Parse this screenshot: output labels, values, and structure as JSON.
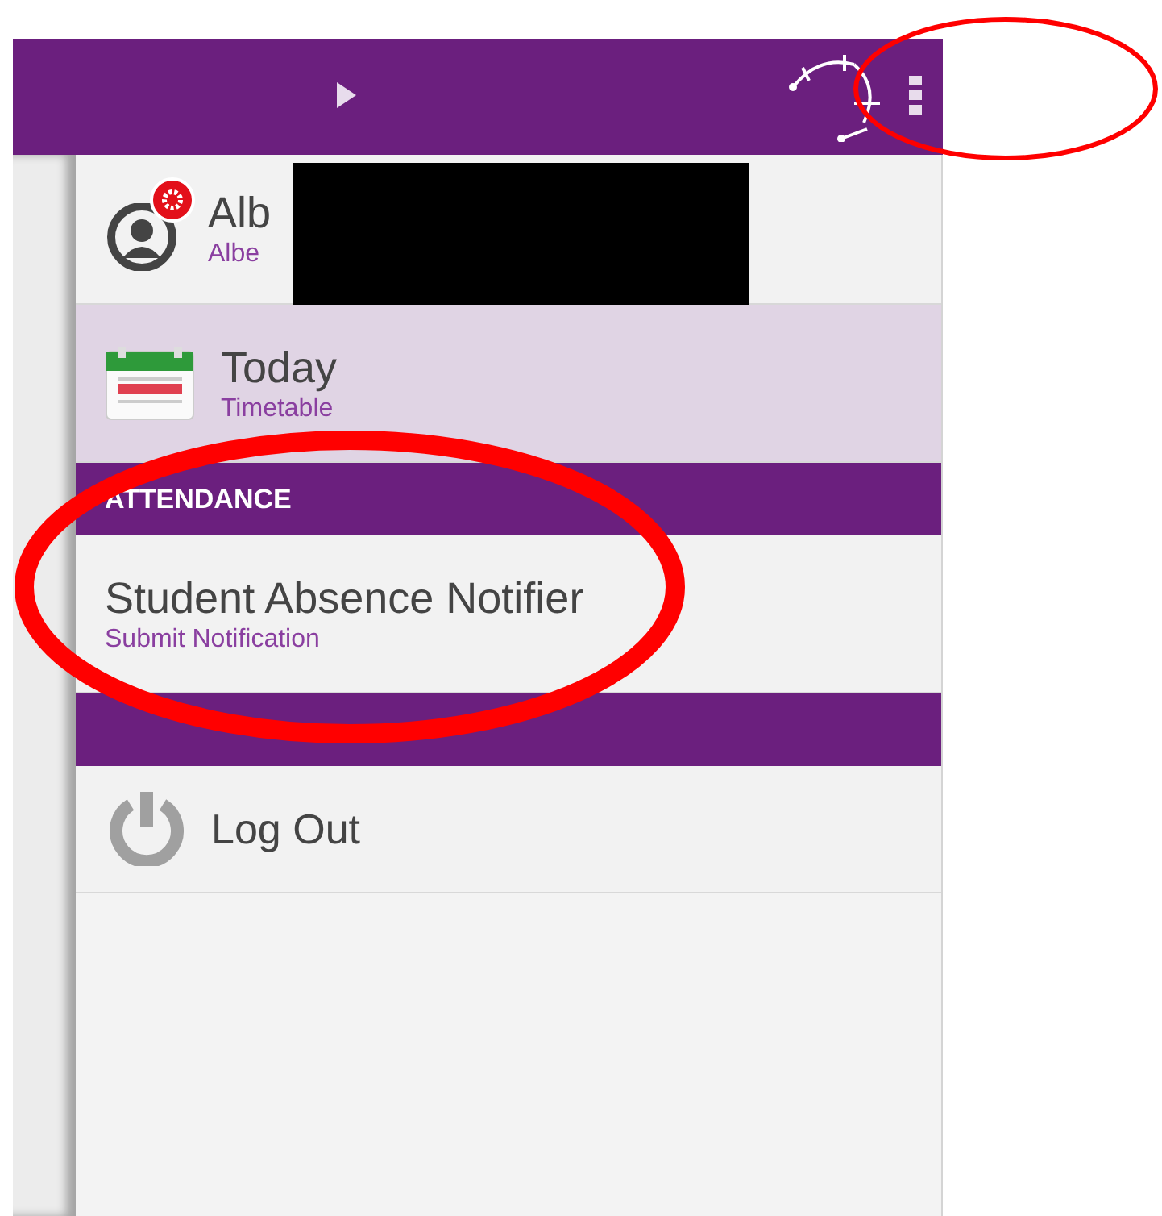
{
  "menu": [
    {
      "kind": "profile",
      "title": "Alb",
      "subtitle": "Albe",
      "badge": true,
      "selected": false
    },
    {
      "kind": "calendar-item",
      "title": "Today",
      "subtitle": "Timetable",
      "selected": true
    },
    {
      "kind": "header",
      "title": "ATTENDANCE"
    },
    {
      "kind": "text-item",
      "title": "Student Absence Notifier",
      "subtitle": "Submit Notification",
      "selected": false
    },
    {
      "kind": "header"
    },
    {
      "kind": "power-item",
      "title": "Log Out",
      "selected": false
    }
  ]
}
